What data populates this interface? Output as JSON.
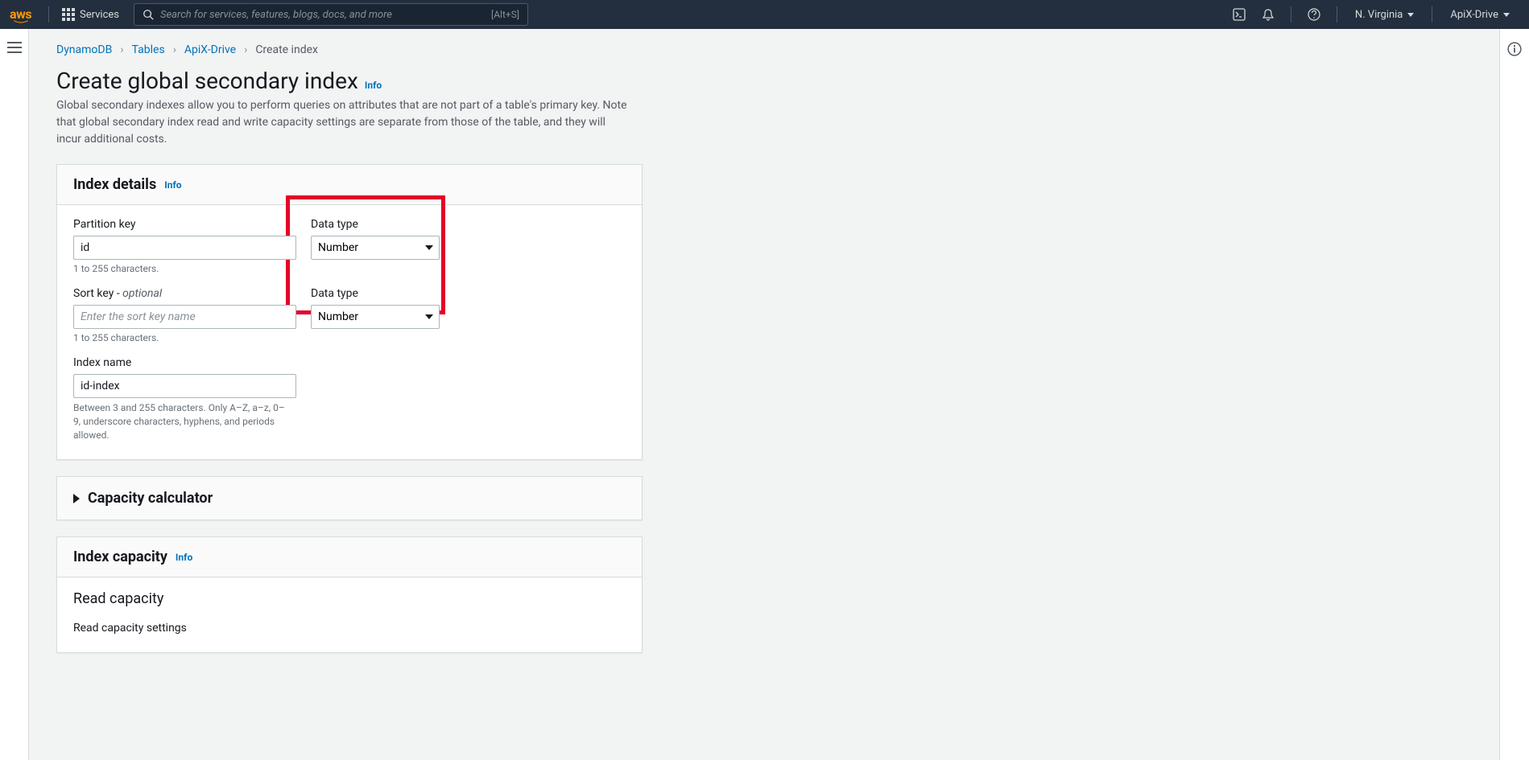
{
  "nav": {
    "services_label": "Services",
    "search_placeholder": "Search for services, features, blogs, docs, and more",
    "search_shortcut": "[Alt+S]",
    "region": "N. Virginia",
    "account": "ApiX-Drive"
  },
  "breadcrumb": {
    "items": [
      "DynamoDB",
      "Tables",
      "ApiX-Drive"
    ],
    "current": "Create index"
  },
  "page": {
    "title": "Create global secondary index",
    "info": "Info",
    "description": "Global secondary indexes allow you to perform queries on attributes that are not part of a table's primary key. Note that global secondary index read and write capacity settings are separate from those of the table, and they will incur additional costs."
  },
  "index_details": {
    "title": "Index details",
    "info": "Info",
    "partition_key_label": "Partition key",
    "partition_key_value": "id",
    "partition_key_type_label": "Data type",
    "partition_key_type_value": "Number",
    "sort_key_label": "Sort key - ",
    "sort_key_optional": "optional",
    "sort_key_placeholder": "Enter the sort key name",
    "sort_key_type_label": "Data type",
    "sort_key_type_value": "Number",
    "hint_chars": "1 to 255 characters.",
    "index_name_label": "Index name",
    "index_name_value": "id-index",
    "index_name_hint": "Between 3 and 255 characters. Only A–Z, a–z, 0–9, underscore characters, hyphens, and periods allowed."
  },
  "capacity_calc": {
    "title": "Capacity calculator"
  },
  "index_capacity": {
    "title": "Index capacity",
    "info": "Info",
    "read_capacity_title": "Read capacity",
    "read_capacity_settings": "Read capacity settings"
  }
}
